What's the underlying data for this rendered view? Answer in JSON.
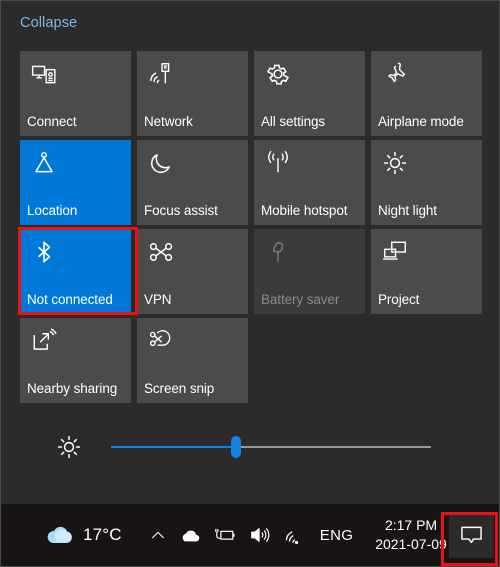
{
  "flyout": {
    "collapse_label": "Collapse",
    "accent_color": "#0078d7",
    "link_color": "#76b9ed",
    "panel_background": "#2b2b2b",
    "tile_background": "#4b4b4b"
  },
  "tiles": [
    {
      "label": "Connect",
      "icon": "connect-icon",
      "state": "off"
    },
    {
      "label": "Network",
      "icon": "network-icon",
      "state": "off"
    },
    {
      "label": "All settings",
      "icon": "gear-icon",
      "state": "off"
    },
    {
      "label": "Airplane mode",
      "icon": "airplane-icon",
      "state": "off"
    },
    {
      "label": "Location",
      "icon": "location-icon",
      "state": "on"
    },
    {
      "label": "Focus assist",
      "icon": "moon-icon",
      "state": "off"
    },
    {
      "label": "Mobile hotspot",
      "icon": "hotspot-icon",
      "state": "off"
    },
    {
      "label": "Night light",
      "icon": "sun-icon",
      "state": "off"
    },
    {
      "label": "Not connected",
      "icon": "bluetooth-icon",
      "state": "on"
    },
    {
      "label": "VPN",
      "icon": "vpn-icon",
      "state": "off"
    },
    {
      "label": "Battery saver",
      "icon": "battery-leaf-icon",
      "state": "disabled"
    },
    {
      "label": "Project",
      "icon": "project-icon",
      "state": "off"
    },
    {
      "label": "Nearby sharing",
      "icon": "nearby-sharing-icon",
      "state": "off"
    },
    {
      "label": "Screen snip",
      "icon": "screen-snip-icon",
      "state": "off"
    }
  ],
  "brightness": {
    "icon": "brightness-icon",
    "value_percent": 39,
    "fill_color": "#0a84e8",
    "track_color": "#9a9a9a"
  },
  "taskbar": {
    "background": "#181414",
    "weather": {
      "icon": "cloud-icon",
      "temperature": "17°C"
    },
    "tray": [
      {
        "icon": "chevron-up-icon"
      },
      {
        "icon": "onedrive-cloud-icon"
      },
      {
        "icon": "battery-charging-icon"
      },
      {
        "icon": "speaker-icon"
      },
      {
        "icon": "wifi-icon"
      }
    ],
    "language": "ENG",
    "clock": {
      "time": "2:17 PM",
      "date": "2021-07-09"
    },
    "action_center_icon": "speech-bubble-icon"
  },
  "annotations": {
    "color": "#ee1111",
    "boxes": [
      {
        "name": "bluetooth-tile-highlight"
      },
      {
        "name": "action-center-button-highlight"
      }
    ]
  }
}
